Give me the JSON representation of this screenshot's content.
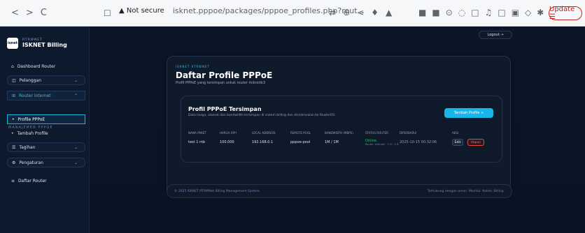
{
  "browser": {
    "nav_back": "<",
    "nav_forward": ">",
    "reload": "C",
    "bookmark": "☐",
    "not_secure": "▲ Not secure",
    "url": "isknet.pppoe/packages/pppoe_profiles.php?rout...",
    "update_label": "Update ☰"
  },
  "sidebar": {
    "brand_sub": "RTRWNET",
    "brand_name": "ISKNET Billing",
    "items": [
      {
        "label": "Dashboard Router"
      },
      {
        "label": "Pelanggan"
      },
      {
        "label": "Router Internet"
      },
      {
        "label": "Profile PPPoE"
      },
      {
        "label": "Tambah Profile"
      },
      {
        "label": "Tagihan"
      },
      {
        "label": "Pengaturan"
      },
      {
        "label": "Daftar Router"
      }
    ],
    "section_label": "MANAJEMEN PPPOE"
  },
  "topbar": {
    "logout": "Logout →"
  },
  "main": {
    "tag": "ISKNET RTRWNET",
    "title": "Daftar Profile PPPoE",
    "desc": "Profil PPPoE yang tersimpan untuk router mikrotik3",
    "inner_title": "Profil PPPoE Tersimpan",
    "inner_desc": "Data harga, alamat dan bandwidth tersimpan di sistem billing dan disinkronkan ke RouterOS.",
    "add_button": "Tambah Profile +"
  },
  "table": {
    "headers": [
      "NAMA PAKET",
      "HARGA (RP)",
      "LOCAL ADDRESS",
      "REMOTE POOL",
      "BANDWIDTH (MBPS)",
      "STATUS ROUTER",
      "DIPERBARUI",
      "AKSI"
    ],
    "rows": [
      {
        "name": "test 1 mb",
        "price": "100.000",
        "local": "192.168.0.1",
        "pool": "pppoe-pool",
        "bw": "1M / 1M",
        "status": "Online",
        "status_sub": "Router: mikrotik · 1 M / 1 M",
        "updated": "2025-10-15 00:32:06",
        "edit": "Edit",
        "delete": "Hapus"
      }
    ]
  },
  "footer": {
    "left": "© 2025 ISKNET RTRWNet Billing Management System.",
    "right": "Terhubung dengan aman. Monitor. Kelola. Billing."
  }
}
